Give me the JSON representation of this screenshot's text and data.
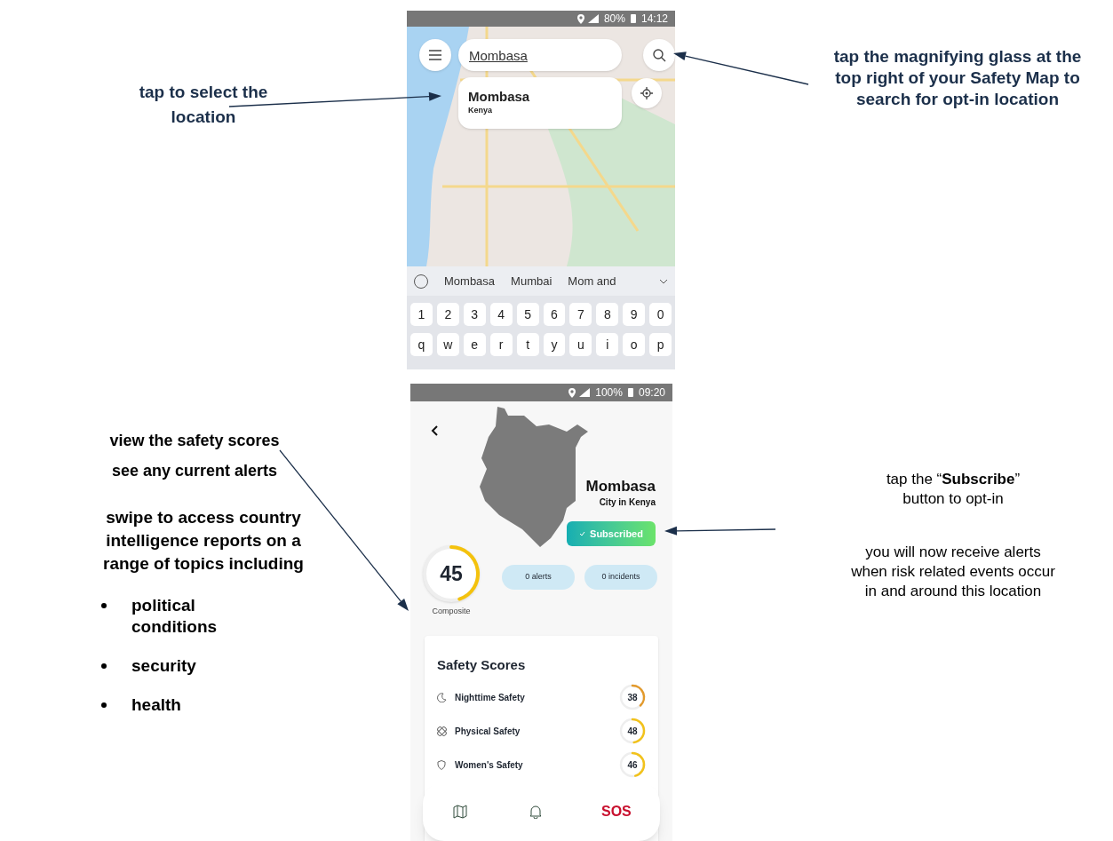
{
  "left_notes": {
    "select": "tap to select the location",
    "scores": [
      "view the safety scores",
      "see any current alerts"
    ],
    "swipe": "swipe to access country intelligence reports on a range of topics including",
    "topics": [
      "political conditions",
      "security",
      "health"
    ]
  },
  "right_notes": {
    "search": "tap the magnifying glass at the top right of your Safety Map to search for opt-in location",
    "subscribe": "tap the “**Subscribe**” button to opt-in",
    "receive": "you will now receive alerts when risk related events occur in and around this location"
  },
  "search_screen": {
    "status_bar": {
      "battery": "80%",
      "time": "14:12"
    },
    "search": {
      "value": "Mombasa"
    },
    "result": {
      "title": "Mombasa",
      "subtitle": "Kenya"
    },
    "suggestions": [
      "Mombasa",
      "Mumbai",
      "Mom and"
    ],
    "keyboard": [
      [
        "1",
        "2",
        "3",
        "4",
        "5",
        "6",
        "7",
        "8",
        "9",
        "0"
      ],
      [
        "q",
        "w",
        "e",
        "r",
        "t",
        "y",
        "u",
        "i",
        "o",
        "p"
      ]
    ]
  },
  "place_screen": {
    "status_bar": {
      "battery": "100%",
      "time": "09:20"
    },
    "title": "Mombasa",
    "subtitle": "City in Kenya",
    "subscribe_button": {
      "label": "Subscribed",
      "subscribed": true
    },
    "composite": {
      "score": "45",
      "label": "Composite",
      "level": 0.45
    },
    "pills": [
      "0 alerts",
      "0 incidents"
    ],
    "card_title": "Safety Scores",
    "scores": [
      {
        "kind": "moon",
        "label": "Nighttime Safety",
        "score": "38",
        "level": 0.38,
        "color": "#e39a2c"
      },
      {
        "kind": "bandage",
        "label": "Physical Safety",
        "score": "48",
        "level": 0.48,
        "color": "#f2c21b"
      },
      {
        "kind": "shield",
        "label": "Women's Safety",
        "score": "46",
        "level": 0.46,
        "color": "#f2c21b"
      }
    ],
    "nav": [
      {
        "kind": "map"
      },
      {
        "kind": "bell"
      },
      {
        "kind": "sos",
        "label": "SOS"
      }
    ]
  }
}
